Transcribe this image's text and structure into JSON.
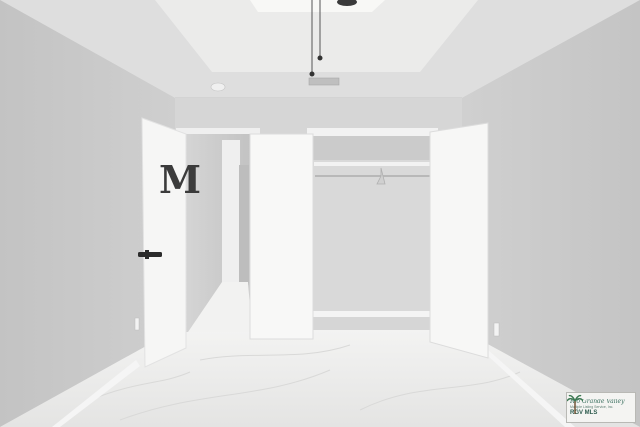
{
  "scene": {
    "door_letter": "M"
  },
  "watermark": {
    "line1": "Rio Grande Valley",
    "line2": "Multiple Listing Service, Inc.",
    "line3": "RGV MLS",
    "logo": "palm-tree-icon"
  },
  "colors": {
    "wall_left": "#c6c6c6",
    "wall_right": "#c9c9c9",
    "ceiling": "#e2e2e2",
    "skylight": "#f6f6f4",
    "door_white": "#f7f7f6",
    "floor": "#ececeb",
    "letter": "#3b3b3b"
  }
}
